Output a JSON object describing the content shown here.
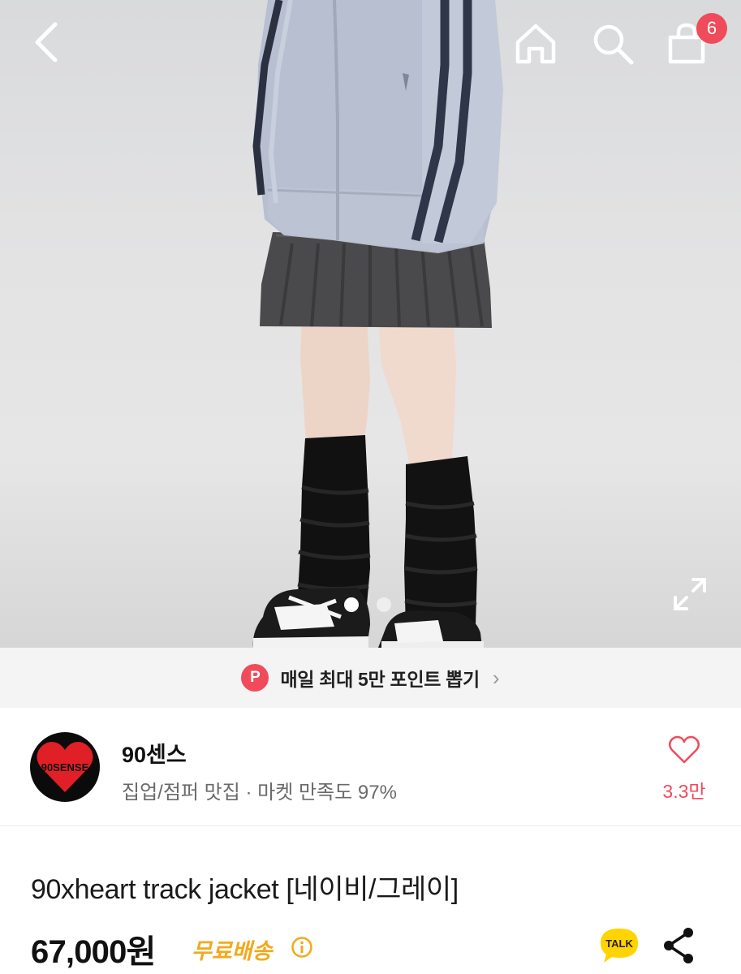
{
  "header": {
    "cart_count": "6",
    "colors": {
      "badge": "#f04b5b",
      "icon": "#ffffff"
    }
  },
  "gallery": {
    "total_slides": 2,
    "active_slide": 1
  },
  "point_banner": {
    "badge": "P",
    "text": "매일 최대 5만 포인트 뽑기",
    "chevron": "›"
  },
  "store": {
    "name": "90센스",
    "description": "집업/점퍼 맛집 · 마켓 만족도 97%",
    "logo_text": "90SENSE",
    "like_count": "3.3만"
  },
  "product": {
    "title": "90xheart track jacket [네이비/그레이]",
    "price": "67,000원",
    "shipping": "무료배송",
    "talk_label": "TALK"
  },
  "icons": {
    "back": "chevron-left-icon",
    "home": "home-icon",
    "search": "search-icon",
    "cart": "shopping-bag-icon",
    "expand": "expand-icon",
    "like": "heart-icon",
    "info": "info-icon",
    "talk": "kakao-talk-icon",
    "share": "share-icon"
  }
}
